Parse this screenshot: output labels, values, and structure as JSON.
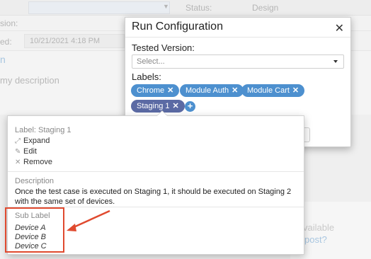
{
  "background": {
    "status_label": "Status:",
    "status_value": "Design",
    "version_label": "sion:",
    "created_label": "ed:",
    "created_value": "10/21/2021 4:18 PM",
    "section_title": "n",
    "description_placeholder": "my description",
    "available_text": "vailable",
    "post_link": "post?"
  },
  "modal": {
    "title": "Run Configuration",
    "close_icon": "close-icon",
    "tested_version_label": "Tested Version:",
    "tested_version_placeholder": "Select...",
    "labels_label": "Labels:",
    "tags": [
      {
        "label": "Chrome",
        "remove": "✕"
      },
      {
        "label": "Module Auth",
        "remove": "✕"
      },
      {
        "label": "Module Cart",
        "remove": "✕"
      },
      {
        "label": "Staging 1",
        "remove": "✕"
      }
    ],
    "add_icon": "+"
  },
  "popover": {
    "header": "Label: Staging 1",
    "actions": [
      {
        "icon": "expand-icon",
        "label": "Expand"
      },
      {
        "icon": "pencil-icon",
        "label": "Edit"
      },
      {
        "icon": "close-icon",
        "label": "Remove"
      }
    ],
    "description_label": "Description",
    "description_text": "Once the test case is executed on Staging 1, it should be executed on Staging 2 with the same set of devices.",
    "sub_label_title": "Sub Label",
    "sub_labels": [
      "Device A",
      "Device B",
      "Device C"
    ]
  },
  "colors": {
    "tag_blue": "#4d90cf",
    "tag_active": "#5b6aa4",
    "annotation": "#e04a2f"
  }
}
